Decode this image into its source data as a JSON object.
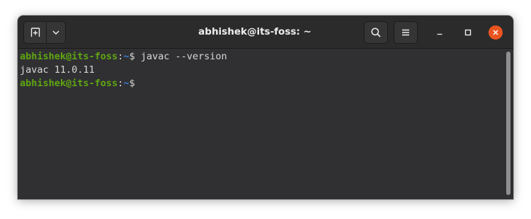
{
  "window": {
    "title": "abhishek@its-foss: ~"
  },
  "headerbar": {
    "new_tab_icon": "new-tab-icon",
    "tab_menu_icon": "chevron-down-icon",
    "search_icon": "search-icon",
    "menu_icon": "hamburger-menu-icon",
    "minimize_icon": "minimize-icon",
    "maximize_icon": "maximize-icon",
    "close_icon": "close-icon"
  },
  "terminal": {
    "lines": [
      {
        "user_host": "abhishek@its-foss",
        "sep": ":",
        "path": "~",
        "symbol": "$ ",
        "command": "javac --version"
      },
      {
        "output": "javac 11.0.11"
      },
      {
        "user_host": "abhishek@its-foss",
        "sep": ":",
        "path": "~",
        "symbol": "$ ",
        "command": ""
      }
    ]
  },
  "colors": {
    "prompt_user": "#5fa611",
    "prompt_path": "#3a80d8",
    "text": "#d8d8d4",
    "background": "#303033",
    "close_button": "#e95420"
  }
}
